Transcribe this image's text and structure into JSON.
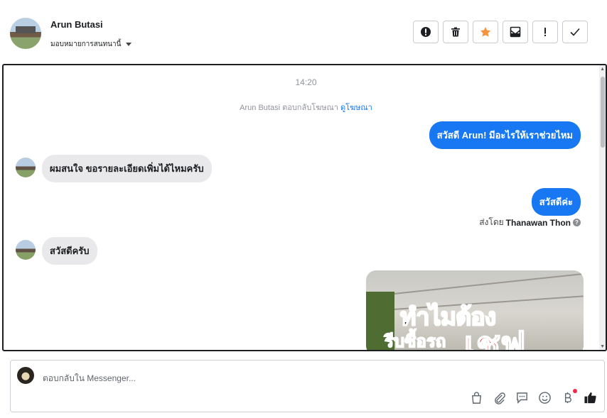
{
  "header": {
    "contact_name": "Arun Butasi",
    "assign_label": "มอบหมายการสนทนานี้",
    "actions": [
      {
        "icon": "alert-circle-icon",
        "name": "mark-spam-button"
      },
      {
        "icon": "trash-icon",
        "name": "delete-button"
      },
      {
        "icon": "star-icon",
        "name": "star-button"
      },
      {
        "icon": "archive-icon",
        "name": "archive-button"
      },
      {
        "icon": "exclamation-icon",
        "name": "follow-up-button"
      },
      {
        "icon": "checkmark-icon",
        "name": "mark-done-button"
      }
    ]
  },
  "conversation": {
    "timestamp": "14:20",
    "replied_prefix": "Arun Butasi ตอบกลับโฆษณา",
    "replied_link": "ดูโฆษณา",
    "messages": {
      "out1": "สวัสดี Arun! มีอะไรให้เราช่วยไหม",
      "in1": "ผมสนใจ ขอรายละเอียดเพิ่มได้ไหมครับ",
      "out2": "สวัสดีค่ะ",
      "in2": "สวัสดีครับ"
    },
    "sent_by_label": "ส่งโดย",
    "sent_by_name": "Thanawan Thon",
    "ad_image_text": {
      "line1": "ทำไมต้อง",
      "line2": "รีบซื้อรถ",
      "line3": "เชฟ"
    }
  },
  "composer": {
    "placeholder": "ตอบกลับใน Messenger...",
    "tools": [
      "shopping-bag-icon",
      "paperclip-icon",
      "saved-reply-icon",
      "emoji-icon",
      "baht-icon",
      "like-icon"
    ]
  },
  "colors": {
    "accent": "#1877f2",
    "incoming_bubble": "#e9e9eb",
    "star": "#f7923b",
    "notification_dot": "#f02849"
  }
}
